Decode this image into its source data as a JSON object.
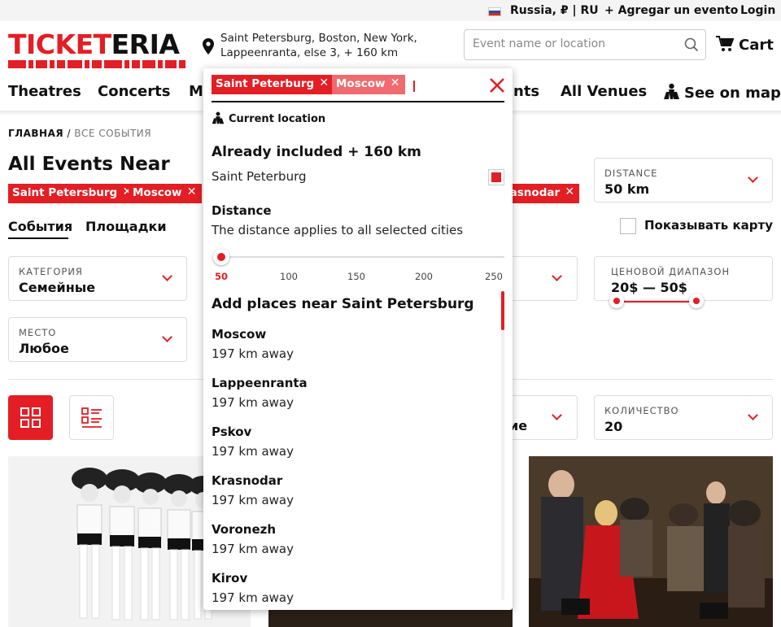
{
  "topbar": {
    "region": "Russia, ₽ | RU",
    "add_event": "+ Agregar un evento",
    "login": "Login"
  },
  "header": {
    "logo": "TICKETERIA",
    "cities_line1": "Saint Petersburg, Boston, New York,",
    "cities_line2": "Lappeenranta, else 3, + 160 km",
    "search_placeholder": "Event name or location",
    "cart": "Cart"
  },
  "nav": {
    "theatres": "Theatres",
    "concerts": "Concerts",
    "mu": "Mu",
    "events_suffix": "nts",
    "all_venues": "All Venues",
    "see_on_map": "See on map"
  },
  "breadcrumb": {
    "home": "ГЛАВНАЯ",
    "separator": " / ",
    "all_events": "ВСЕ СОБЫТИЯ"
  },
  "page": {
    "title": "All Events Near",
    "chips": [
      "Saint Petersburg",
      "Moscow",
      "rasnodar"
    ]
  },
  "distance_filter": {
    "label": "DISTANCE",
    "value": "50 km"
  },
  "tabs": {
    "events": "События",
    "venues": "Площадки"
  },
  "show_map": "Показывать карту",
  "filters": {
    "category_label": "КАТЕГОРИЯ",
    "category_value": "Семейные",
    "price_label": "ЦЕНОВОЙ ДИАПАЗОН",
    "price_value": "20$ — 50$",
    "place_label": "МЕСТО",
    "place_value": "Любое",
    "sort_suffix": "ие",
    "count_label": "КОЛИЧЕСТВО",
    "count_value": "20"
  },
  "dropdown": {
    "chips": [
      "Saint Peterburg",
      "Moscow"
    ],
    "current_location": "Current location",
    "included_title": "Already included + 160 km",
    "included_city": "Saint Peterburg",
    "distance_title": "Distance",
    "distance_note": "The distance applies to all selected cities",
    "slider": {
      "value": 50,
      "min": 50,
      "max": 250,
      "labels": [
        "50",
        "100",
        "150",
        "200",
        "250"
      ]
    },
    "add_places_title": "Add places near Saint Petersburg",
    "places": [
      {
        "name": "Moscow",
        "distance": "197 km away"
      },
      {
        "name": "Lappeenranta",
        "distance": "197 km away"
      },
      {
        "name": "Pskov",
        "distance": "197 km away"
      },
      {
        "name": "Krasnodar",
        "distance": "197 km away"
      },
      {
        "name": "Voronezh",
        "distance": "197 km away"
      },
      {
        "name": "Kirov",
        "distance": "197 km away"
      }
    ]
  },
  "colors": {
    "accent": "#e31e24",
    "chip_light": "#f06b6f"
  }
}
